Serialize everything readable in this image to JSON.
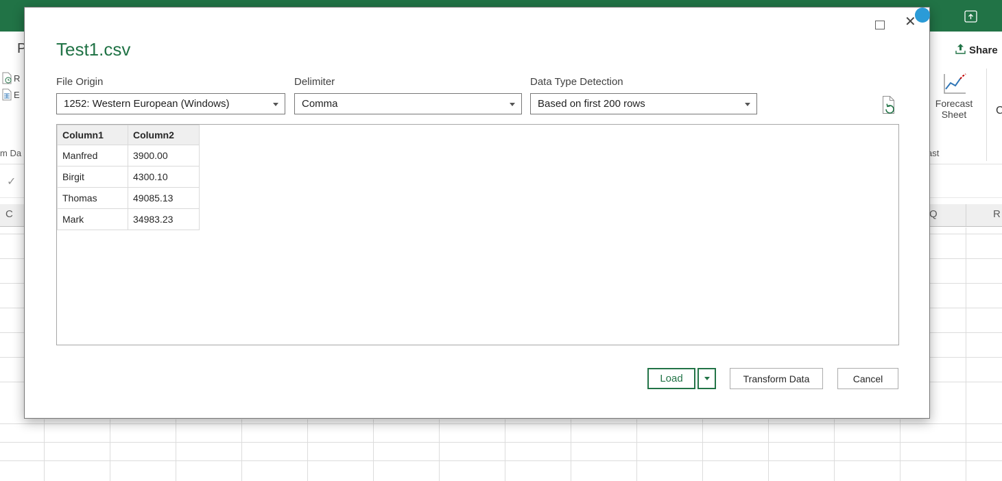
{
  "colors": {
    "accent": "#217346",
    "titlebar": "#217346",
    "avatar": "#2B9BD7",
    "grid_line": "#DCDCDC"
  },
  "titlebar": {},
  "ribbon": {
    "share_label": "Share",
    "forecast_line1": "Forecast",
    "forecast_line2": "Sheet",
    "fragments": {
      "p": "P",
      "recent": "R",
      "existing": "E",
      "group_left": "m Da",
      "group_right": "ast",
      "right_edge": "C"
    },
    "formula_checkmark": "✓"
  },
  "grid": {
    "col_left": "C",
    "col_q": "Q",
    "col_r": "R"
  },
  "dialog": {
    "title": "Test1.csv",
    "close_glyph": "✕",
    "fields": [
      {
        "label": "File Origin",
        "value": "1252: Western European (Windows)"
      },
      {
        "label": "Delimiter",
        "value": "Comma"
      },
      {
        "label": "Data Type Detection",
        "value": "Based on first 200 rows"
      }
    ],
    "table": {
      "columns": [
        "Column1",
        "Column2"
      ],
      "rows": [
        [
          "Manfred",
          "3900.00"
        ],
        [
          "Birgit",
          "4300.10"
        ],
        [
          "Thomas",
          "49085.13"
        ],
        [
          "Mark",
          "34983.23"
        ]
      ]
    },
    "buttons": {
      "load": "Load",
      "transform": "Transform Data",
      "cancel": "Cancel"
    }
  }
}
